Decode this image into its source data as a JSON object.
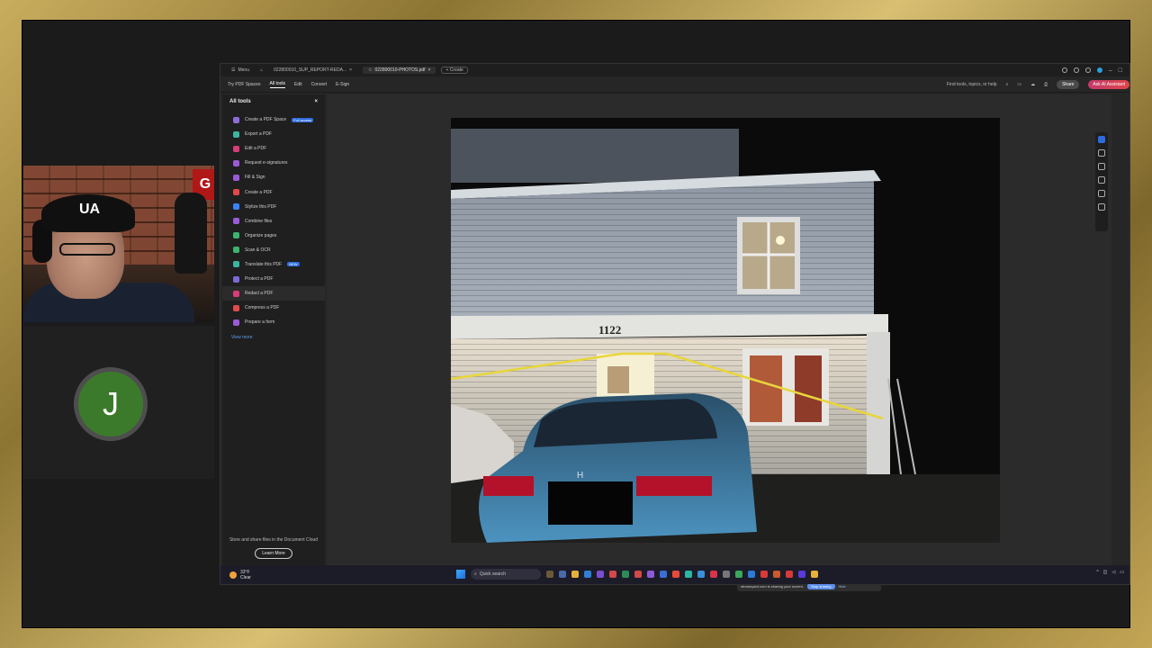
{
  "app": {
    "tabs": [
      {
        "label": "Menu"
      },
      {
        "label": "022800010_SUP_REPORT-REDA..."
      },
      {
        "label": "022800010-PHOTOS.pdf"
      }
    ],
    "create_label": "Create"
  },
  "toolbar": {
    "try_spaces": "Try PDF Spaces",
    "menus": [
      "All tools",
      "Edit",
      "Convert",
      "E-Sign"
    ],
    "find_placeholder": "Find tools, topics, or help",
    "share_label": "Share",
    "ai_label": "Ask AI Assistant"
  },
  "sidebar": {
    "title": "All tools",
    "items": [
      {
        "label": "Create a PDF Space",
        "color": "#8f6bd8",
        "badge": "Full access"
      },
      {
        "label": "Export a PDF",
        "color": "#3cb4a0"
      },
      {
        "label": "Edit a PDF",
        "color": "#d93c7a"
      },
      {
        "label": "Request e-signatures",
        "color": "#9b5bd6"
      },
      {
        "label": "Fill & Sign",
        "color": "#9b5bd6"
      },
      {
        "label": "Create a PDF",
        "color": "#e24a4a"
      },
      {
        "label": "Stylize this PDF",
        "color": "#3b82f6"
      },
      {
        "label": "Combine files",
        "color": "#9b5bd6"
      },
      {
        "label": "Organize pages",
        "color": "#3cb46e"
      },
      {
        "label": "Scan & OCR",
        "color": "#3cb46e"
      },
      {
        "label": "Translate this PDF",
        "color": "#3cb4a0",
        "badge": "NEW"
      },
      {
        "label": "Protect a PDF",
        "color": "#7a6bd8"
      },
      {
        "label": "Redact a PDF",
        "color": "#d93c7a"
      },
      {
        "label": "Compress a PDF",
        "color": "#e24a4a"
      },
      {
        "label": "Prepare a form",
        "color": "#9b5bd6"
      }
    ],
    "view_more": "View more",
    "cloud_text": "Store and share files in the Document Cloud",
    "learn_more": "Learn More"
  },
  "photo": {
    "house_number": "1122"
  },
  "share_bar": {
    "message": "streamyard.com is sharing your screen.",
    "stop_label": "Stop sharing",
    "hide_label": "Hide"
  },
  "taskbar": {
    "temp": "33°F",
    "condition": "Clear",
    "search_label": "Quick search"
  },
  "webcam": {
    "sign_letter": "G",
    "cap_logo": "UA"
  },
  "avatar": {
    "initial": "J",
    "color": "#3c7a2b"
  }
}
